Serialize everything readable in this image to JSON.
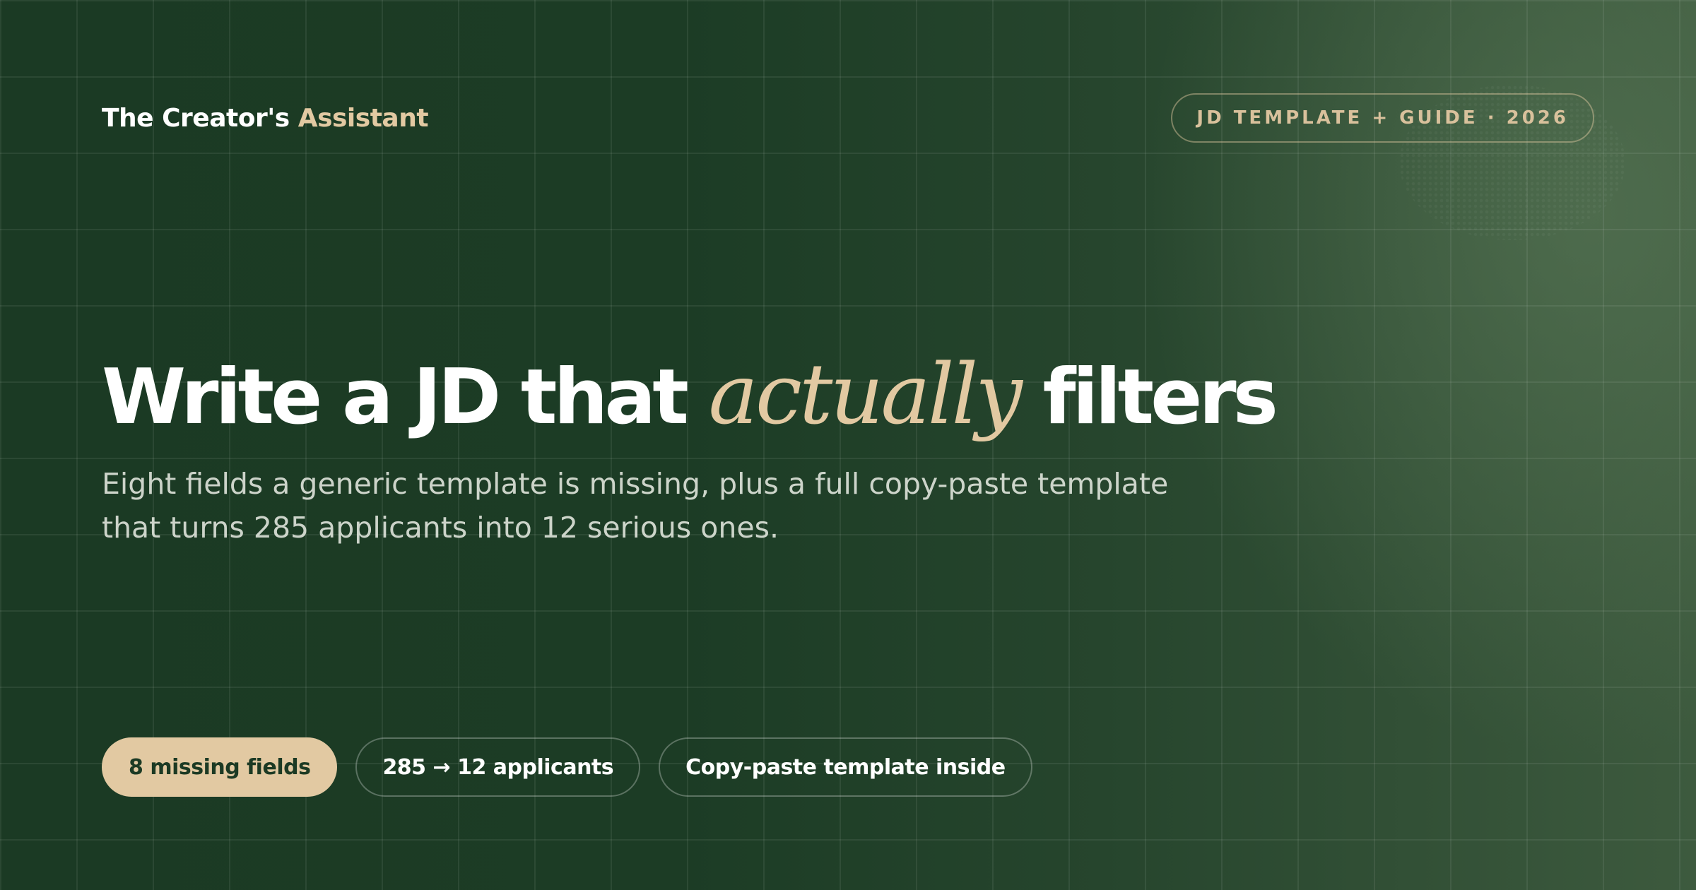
{
  "brand": {
    "name_part1": "The Creator's ",
    "name_part2": "Assistant"
  },
  "tag": "JD TEMPLATE + GUIDE · 2026",
  "headline": {
    "before": "Write a JD that ",
    "emphasis": "actually",
    "after": " filters"
  },
  "subheadline": "Eight fields a generic template is missing, plus a full copy-paste template that turns 285 applicants into 12 serious ones.",
  "chips": [
    {
      "label": "8 missing fields"
    },
    {
      "label": "285 → 12 applicants"
    },
    {
      "label": "Copy-paste template inside"
    }
  ],
  "colors": {
    "background": "#1b3a24",
    "accent": "#e2c9a2",
    "text": "#ffffff"
  }
}
